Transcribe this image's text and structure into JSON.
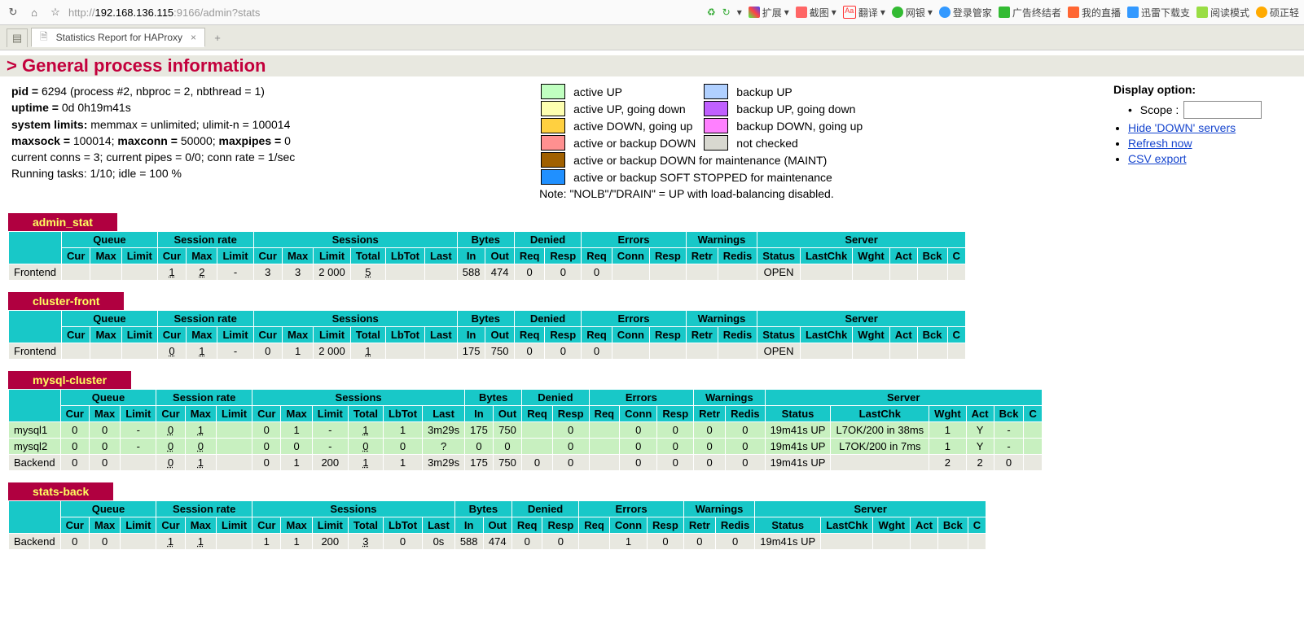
{
  "browser": {
    "url_prefix": "http://",
    "url_host": "192.168.136.115",
    "url_path": ":9166/admin?stats",
    "tab_title": "Statistics Report for HAProxy",
    "ext": [
      "扩展",
      "截图",
      "翻译",
      "网银",
      "登录管家",
      "广告终结者",
      "我的直播",
      "迅雷下载支",
      "阅读模式",
      "硕正轻"
    ]
  },
  "title": "General process information",
  "proc": {
    "pid_label": "pid = ",
    "pid_val": "6294 (process #2, nbproc = 2, nbthread = 1)",
    "uptime_label": "uptime = ",
    "uptime_val": "0d 0h19m41s",
    "limits_label": "system limits:",
    "limits_val": " memmax = unlimited; ulimit-n = 100014",
    "sock_label": "maxsock = ",
    "sock_val": "100014; ",
    "conn_label": "maxconn = ",
    "conn_val": "50000; ",
    "pipes_label": "maxpipes = ",
    "pipes_val": "0",
    "cur": "current conns = 3; current pipes = 0/0; conn rate = 1/sec",
    "tasks": "Running tasks: 1/10; idle = 100 %"
  },
  "legend": {
    "aup": "active UP",
    "bup": "backup UP",
    "aupd": "active UP, going down",
    "bupd": "backup UP, going down",
    "admu": "active DOWN, going up",
    "bdmu": "backup DOWN, going up",
    "down": "active or backup DOWN",
    "nc": "not checked",
    "maint": "active or backup DOWN for maintenance (MAINT)",
    "soft": "active or backup SOFT STOPPED for maintenance",
    "note": "Note: \"NOLB\"/\"DRAIN\" = UP with load-balancing disabled."
  },
  "options": {
    "hdr": "Display option:",
    "scope": "Scope :",
    "hide": "Hide 'DOWN' servers",
    "refresh": "Refresh now",
    "csv": "CSV export"
  },
  "cols": {
    "queue": "Queue",
    "srate": "Session rate",
    "sess": "Sessions",
    "bytes": "Bytes",
    "denied": "Denied",
    "errors": "Errors",
    "warn": "Warnings",
    "server": "Server",
    "cur": "Cur",
    "max": "Max",
    "limit": "Limit",
    "total": "Total",
    "lbtot": "LbTot",
    "last": "Last",
    "in": "In",
    "out": "Out",
    "req": "Req",
    "resp": "Resp",
    "conn": "Conn",
    "retr": "Retr",
    "redis": "Redis",
    "status": "Status",
    "lastchk": "LastChk",
    "wght": "Wght",
    "act": "Act",
    "bck": "Bck",
    "chk": "C"
  },
  "sections": [
    {
      "name": "admin_stat",
      "rows": [
        {
          "name": "Frontend",
          "cls": "",
          "q": [
            "",
            "",
            ""
          ],
          "sr": [
            "1",
            "2",
            "-"
          ],
          "s": [
            "3",
            "3",
            "2 000",
            "5",
            "",
            ""
          ],
          "b": [
            "588",
            "474"
          ],
          "d": [
            "0",
            "0"
          ],
          "e": [
            "0",
            "",
            ""
          ],
          "w": [
            "",
            ""
          ],
          "srv": [
            "OPEN",
            "",
            "",
            "",
            "",
            ""
          ]
        }
      ]
    },
    {
      "name": "cluster-front",
      "rows": [
        {
          "name": "Frontend",
          "cls": "",
          "q": [
            "",
            "",
            ""
          ],
          "sr": [
            "0",
            "1",
            "-"
          ],
          "s": [
            "0",
            "1",
            "2 000",
            "1",
            "",
            ""
          ],
          "b": [
            "175",
            "750"
          ],
          "d": [
            "0",
            "0"
          ],
          "e": [
            "0",
            "",
            ""
          ],
          "w": [
            "",
            ""
          ],
          "srv": [
            "OPEN",
            "",
            "",
            "",
            "",
            ""
          ]
        }
      ]
    },
    {
      "name": "mysql-cluster",
      "rows": [
        {
          "name": "mysql1",
          "cls": "up",
          "q": [
            "0",
            "0",
            "-"
          ],
          "sr": [
            "0",
            "1",
            ""
          ],
          "s": [
            "0",
            "1",
            "-",
            "1",
            "1",
            "3m29s"
          ],
          "b": [
            "175",
            "750"
          ],
          "d": [
            "",
            "0"
          ],
          "e": [
            "",
            "0",
            "0"
          ],
          "w": [
            "0",
            "0"
          ],
          "srv": [
            "19m41s UP",
            "L7OK/200 in 38ms",
            "1",
            "Y",
            "-",
            ""
          ]
        },
        {
          "name": "mysql2",
          "cls": "up",
          "q": [
            "0",
            "0",
            "-"
          ],
          "sr": [
            "0",
            "0",
            ""
          ],
          "s": [
            "0",
            "0",
            "-",
            "0",
            "0",
            "?"
          ],
          "b": [
            "0",
            "0"
          ],
          "d": [
            "",
            "0"
          ],
          "e": [
            "",
            "0",
            "0"
          ],
          "w": [
            "0",
            "0"
          ],
          "srv": [
            "19m41s UP",
            "L7OK/200 in 7ms",
            "1",
            "Y",
            "-",
            ""
          ]
        },
        {
          "name": "Backend",
          "cls": "",
          "q": [
            "0",
            "0",
            ""
          ],
          "sr": [
            "0",
            "1",
            ""
          ],
          "s": [
            "0",
            "1",
            "200",
            "1",
            "1",
            "3m29s"
          ],
          "b": [
            "175",
            "750"
          ],
          "d": [
            "0",
            "0"
          ],
          "e": [
            "",
            "0",
            "0"
          ],
          "w": [
            "0",
            "0"
          ],
          "srv": [
            "19m41s UP",
            "",
            "2",
            "2",
            "0",
            ""
          ]
        }
      ]
    },
    {
      "name": "stats-back",
      "rows": [
        {
          "name": "Backend",
          "cls": "",
          "q": [
            "0",
            "0",
            ""
          ],
          "sr": [
            "1",
            "1",
            ""
          ],
          "s": [
            "1",
            "1",
            "200",
            "3",
            "0",
            "0s"
          ],
          "b": [
            "588",
            "474"
          ],
          "d": [
            "0",
            "0"
          ],
          "e": [
            "",
            "1",
            "0"
          ],
          "w": [
            "0",
            "0"
          ],
          "srv": [
            "19m41s UP",
            "",
            "",
            "",
            "",
            ""
          ]
        }
      ]
    }
  ]
}
